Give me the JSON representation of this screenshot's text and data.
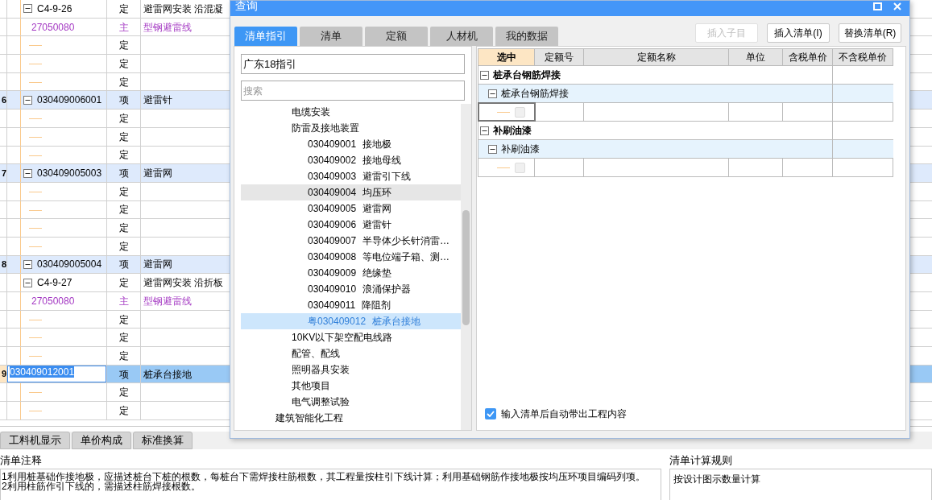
{
  "main_table": {
    "rows": [
      {
        "children": [
          {
            "kind": "quota",
            "code": "C4-9-26",
            "type": "定",
            "name": "避雷网安装 沿混凝",
            "expanded": true,
            "children": [
              {
                "kind": "material",
                "code": "27050080",
                "type": "主",
                "name": "型钢避雷线"
              }
            ]
          },
          {
            "kind": "quota",
            "type": "定"
          },
          {
            "kind": "quota",
            "type": "定"
          },
          {
            "kind": "quota",
            "type": "定"
          }
        ]
      },
      {
        "kind": "item",
        "number": "6",
        "code": "030409006001",
        "type": "项",
        "name": "避雷针",
        "expanded": true,
        "selected": false,
        "children": [
          {
            "kind": "quota",
            "type": "定"
          },
          {
            "kind": "quota",
            "type": "定"
          },
          {
            "kind": "quota",
            "type": "定"
          }
        ]
      },
      {
        "kind": "item",
        "number": "7",
        "code": "030409005003",
        "type": "项",
        "name": "避雷网",
        "expanded": true,
        "selected": false,
        "children": [
          {
            "kind": "quota",
            "type": "定"
          },
          {
            "kind": "quota",
            "type": "定"
          },
          {
            "kind": "quota",
            "type": "定"
          },
          {
            "kind": "quota",
            "type": "定"
          }
        ]
      },
      {
        "kind": "item",
        "number": "8",
        "code": "030409005004",
        "type": "项",
        "name": "避雷网",
        "expanded": true,
        "selected": false,
        "children": [
          {
            "kind": "quota",
            "code": "C4-9-27",
            "type": "定",
            "name": "避雷网安装 沿折板",
            "expanded": true,
            "children": [
              {
                "kind": "material",
                "code": "27050080",
                "type": "主",
                "name": "型钢避雷线"
              }
            ]
          },
          {
            "kind": "quota",
            "type": "定"
          },
          {
            "kind": "quota",
            "type": "定"
          },
          {
            "kind": "quota",
            "type": "定"
          }
        ]
      },
      {
        "kind": "item",
        "number": "9",
        "code": "030409012001",
        "type": "项",
        "name": "桩承台接地",
        "selected": true,
        "children": [
          {
            "kind": "quota",
            "type": "定"
          },
          {
            "kind": "quota",
            "type": "定"
          }
        ]
      }
    ]
  },
  "bottom_tabs": [
    {
      "label": "工料机显示",
      "selected": false
    },
    {
      "label": "单价构成",
      "selected": false
    },
    {
      "label": "标准换算",
      "selected": false
    }
  ],
  "notes": {
    "title": "清单注释",
    "lines": [
      "1利用桩基础作接地极，应描述桩台下桩的根数，每桩台下需焊接柱筋根数，其工程量按柱引下线计算；利用基础钢筋作接地极按均压环项目编码列项。",
      "2利用柱筋作引下线的，需描述柱筋焊接根数。"
    ]
  },
  "rules": {
    "title": "清单计算规则",
    "text": "按设计图示数量计算"
  },
  "dialog": {
    "title": "查询",
    "tabs": [
      {
        "label": "清单指引",
        "selected": true
      },
      {
        "label": "清单",
        "selected": false
      },
      {
        "label": "定额",
        "selected": false
      },
      {
        "label": "人材机",
        "selected": false
      },
      {
        "label": "我的数据",
        "selected": false
      }
    ],
    "buttons": [
      {
        "label": "插入子目",
        "disabled": true
      },
      {
        "label": "插入清单(I)",
        "disabled": false
      },
      {
        "label": "替换清单(R)",
        "disabled": false
      }
    ],
    "guide": {
      "value": "广东18指引"
    },
    "search": {
      "placeholder": "搜索"
    },
    "tree": [
      {
        "children": [
          {
            "label": "电缆安装",
            "selected": false,
            "hovered": false
          },
          {
            "label": "防雷及接地装置",
            "selected": false,
            "hovered": false,
            "children": [
              {
                "code": "030409001",
                "name": "接地极",
                "selected": false,
                "hovered": false
              },
              {
                "code": "030409002",
                "name": "接地母线",
                "selected": false,
                "hovered": false
              },
              {
                "code": "030409003",
                "name": "避雷引下线",
                "selected": false,
                "hovered": false
              },
              {
                "code": "030409004",
                "name": "均压环",
                "selected": false,
                "hovered": true
              },
              {
                "code": "030409005",
                "name": "避雷网",
                "selected": false,
                "hovered": false
              },
              {
                "code": "030409006",
                "name": "避雷针",
                "selected": false,
                "hovered": false
              },
              {
                "code": "030409007",
                "name": "半导体少长针消雷…",
                "selected": false,
                "hovered": false
              },
              {
                "code": "030409008",
                "name": "等电位端子箱、测…",
                "selected": false,
                "hovered": false
              },
              {
                "code": "030409009",
                "name": "绝缘垫",
                "selected": false,
                "hovered": false
              },
              {
                "code": "030409010",
                "name": "浪涌保护器",
                "selected": false,
                "hovered": false
              },
              {
                "code": "030409011",
                "name": "降阻剂",
                "selected": false,
                "hovered": false
              },
              {
                "code": "粤030409012",
                "name": "桩承台接地",
                "selected": true,
                "hovered": false
              }
            ]
          },
          {
            "label": "10KV以下架空配电线路",
            "selected": false,
            "hovered": false
          },
          {
            "label": "配管、配线",
            "selected": false,
            "hovered": false
          },
          {
            "label": "照明器具安装",
            "selected": false,
            "hovered": false
          },
          {
            "label": "其他项目",
            "selected": false,
            "hovered": false
          },
          {
            "label": "电气调整试验",
            "selected": false,
            "hovered": false
          }
        ]
      },
      {
        "label": "建筑智能化工程",
        "selected": false,
        "hovered": false
      }
    ],
    "columns": [
      {
        "label": "选中",
        "selected": true
      },
      {
        "label": "定额号",
        "selected": false
      },
      {
        "label": "定额名称",
        "selected": false
      },
      {
        "label": "单位",
        "selected": false
      },
      {
        "label": "含税单价",
        "selected": false
      },
      {
        "label": "不含税单价",
        "selected": false
      }
    ],
    "groups": [
      {
        "name": "桩承台钢筋焊接",
        "expanded": true,
        "children": [
          {
            "name": "桩承台钢筋焊接",
            "expanded": true,
            "rows": [
              {
                "checked": false,
                "focused": true
              }
            ]
          }
        ]
      },
      {
        "name": "补刷油漆",
        "expanded": true,
        "children": [
          {
            "name": "补刷油漆",
            "expanded": true,
            "rows": [
              {
                "checked": false,
                "focused": false
              }
            ]
          }
        ]
      }
    ],
    "auto_fill": {
      "label": "输入清单后自动带出工程内容",
      "checked": true
    }
  }
}
